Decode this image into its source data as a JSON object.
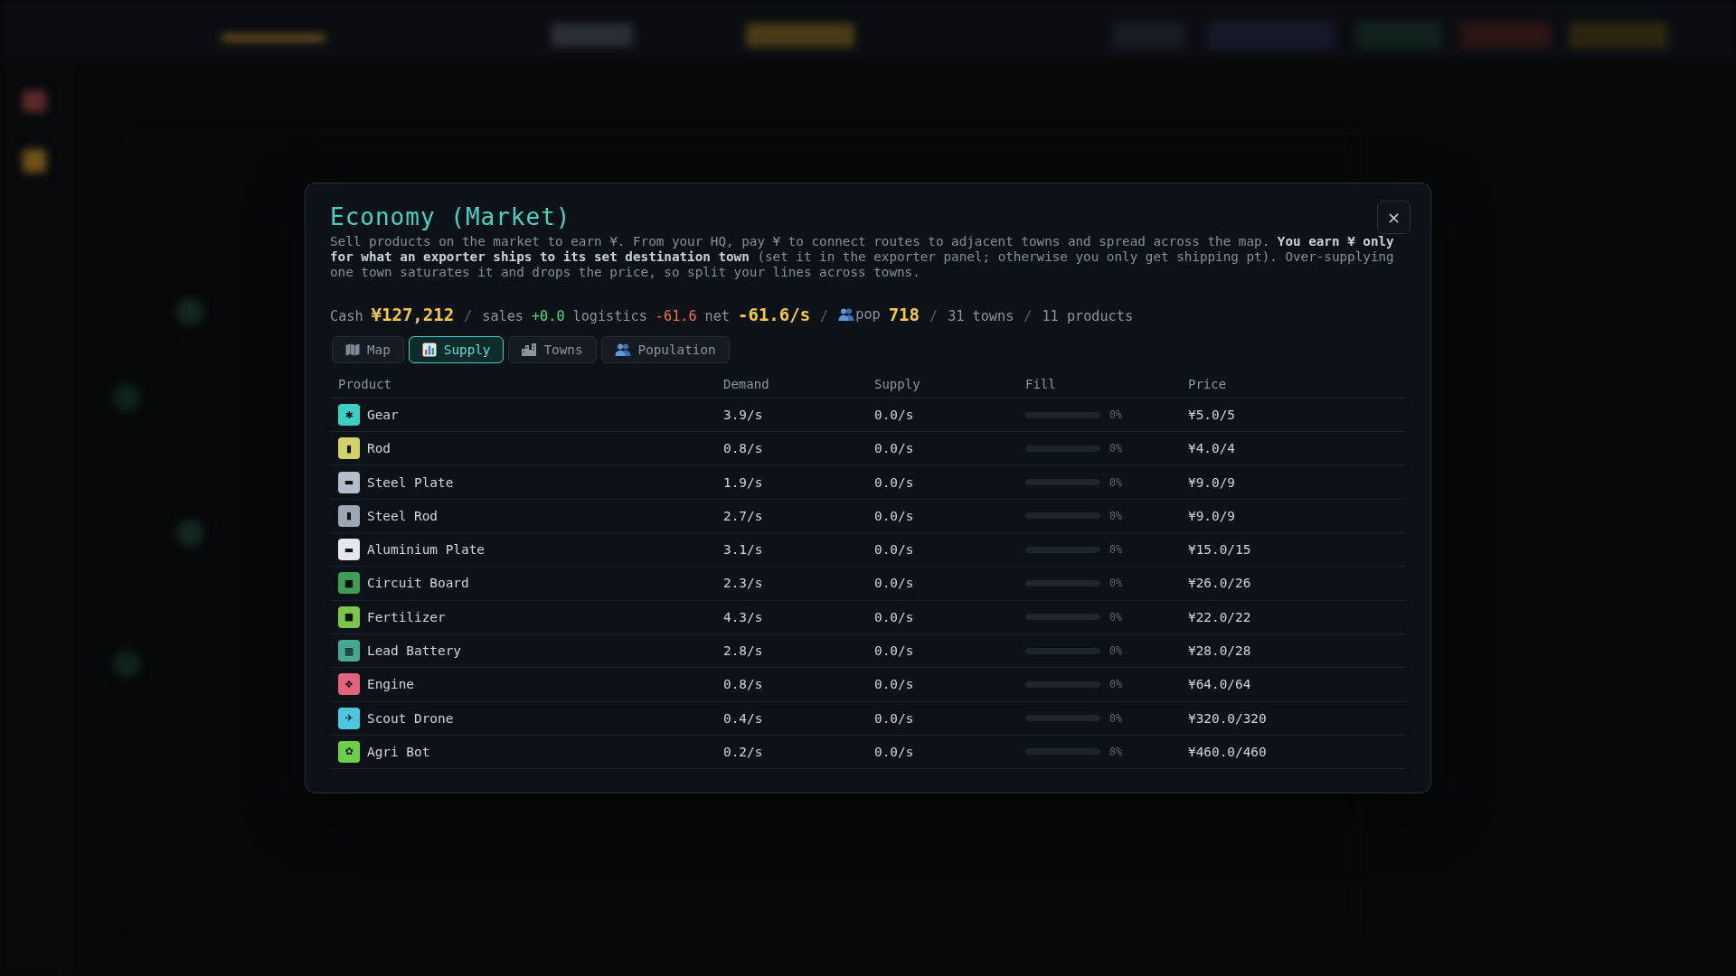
{
  "modal": {
    "title": "Economy (Market)",
    "close": "×",
    "description": "Sell products on the market to earn ¥. From your HQ, pay ¥ to connect routes to adjacent towns and spread across the map. **You earn ¥ only for what an exporter ships to its set destination town** (set it in the exporter panel; otherwise you only get shipping pt). Over-supplying one town saturates it and drops the price, so split your lines across towns.",
    "stats": [
      {
        "kind": "label",
        "text": "Cash"
      },
      {
        "kind": "big",
        "text": "¥127,212"
      },
      {
        "kind": "sep",
        "text": "/"
      },
      {
        "kind": "label",
        "text": "sales"
      },
      {
        "kind": "pos",
        "text": "+0.0"
      },
      {
        "kind": "label",
        "text": "logistics"
      },
      {
        "kind": "neg",
        "text": "-61.6"
      },
      {
        "kind": "label",
        "text": "net"
      },
      {
        "kind": "big",
        "text": "-61.6/s"
      },
      {
        "kind": "sep",
        "text": "/"
      },
      {
        "kind": "pop",
        "text": "pop"
      },
      {
        "kind": "big",
        "text": "718"
      },
      {
        "kind": "sep",
        "text": "/"
      },
      {
        "kind": "label",
        "text": "31 towns"
      },
      {
        "kind": "sep",
        "text": "/"
      },
      {
        "kind": "label",
        "text": "11 products"
      }
    ],
    "tabs": [
      {
        "label": "Map",
        "selected": false
      },
      {
        "label": "Supply",
        "selected": true
      },
      {
        "label": "Towns",
        "selected": false
      },
      {
        "label": "Population",
        "selected": false
      }
    ],
    "table": {
      "columns": [
        "Product",
        "Demand",
        "Supply",
        "Fill",
        "Price"
      ],
      "rows": [
        {
          "name": "Gear",
          "icon": "✱",
          "color": "#3ecfc4",
          "demand": "3.9/s",
          "supply": "0.0/s",
          "level": 0,
          "fill_text": "0%",
          "price": "¥5.0/5"
        },
        {
          "name": "Rod",
          "icon": "▮",
          "color": "#d2d26a",
          "demand": "0.8/s",
          "supply": "0.0/s",
          "level": 0,
          "fill_text": "0%",
          "price": "¥4.0/4"
        },
        {
          "name": "Steel Plate",
          "icon": "▬",
          "color": "#b5bdca",
          "demand": "1.9/s",
          "supply": "0.0/s",
          "level": 0,
          "fill_text": "0%",
          "price": "¥9.0/9"
        },
        {
          "name": "Steel Rod",
          "icon": "▮",
          "color": "#9ea6b3",
          "demand": "2.7/s",
          "supply": "0.0/s",
          "level": 0,
          "fill_text": "0%",
          "price": "¥9.0/9"
        },
        {
          "name": "Aluminium Plate",
          "icon": "▬",
          "color": "#e4e8ee",
          "demand": "3.1/s",
          "supply": "0.0/s",
          "level": 0,
          "fill_text": "0%",
          "price": "¥15.0/15"
        },
        {
          "name": "Circuit Board",
          "icon": "■",
          "color": "#3f9e55",
          "demand": "2.3/s",
          "supply": "0.0/s",
          "level": 0,
          "fill_text": "0%",
          "price": "¥26.0/26"
        },
        {
          "name": "Fertilizer",
          "icon": "■",
          "color": "#7bc548",
          "demand": "4.3/s",
          "supply": "0.0/s",
          "level": 0,
          "fill_text": "0%",
          "price": "¥22.0/22"
        },
        {
          "name": "Lead Battery",
          "icon": "▩",
          "color": "#45a892",
          "demand": "2.8/s",
          "supply": "0.0/s",
          "level": 0,
          "fill_text": "0%",
          "price": "¥28.0/28"
        },
        {
          "name": "Engine",
          "icon": "❖",
          "color": "#e4627c",
          "demand": "0.8/s",
          "supply": "0.0/s",
          "level": 0,
          "fill_text": "0%",
          "price": "¥64.0/64"
        },
        {
          "name": "Scout Drone",
          "icon": "✈",
          "color": "#4ec6de",
          "demand": "0.4/s",
          "supply": "0.0/s",
          "level": 0,
          "fill_text": "0%",
          "price": "¥320.0/320"
        },
        {
          "name": "Agri Bot",
          "icon": "✿",
          "color": "#6ccf4a",
          "demand": "0.2/s",
          "supply": "0.0/s",
          "level": 0,
          "fill_text": "0%",
          "price": "¥460.0/460"
        }
      ]
    }
  }
}
